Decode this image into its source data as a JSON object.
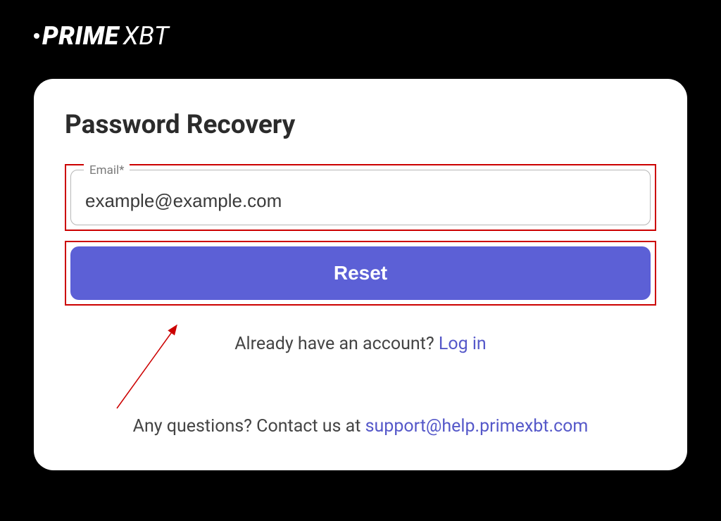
{
  "brand": {
    "prime": "PRIME",
    "xbt": "XBT"
  },
  "card": {
    "title": "Password Recovery",
    "email": {
      "label": "Email*",
      "value": "example@example.com"
    },
    "reset_label": "Reset",
    "login": {
      "prefix": "Already have an account? ",
      "link": "Log in"
    },
    "contact": {
      "prefix": "Any questions? Contact us at ",
      "email": "support@help.primexbt.com"
    }
  }
}
